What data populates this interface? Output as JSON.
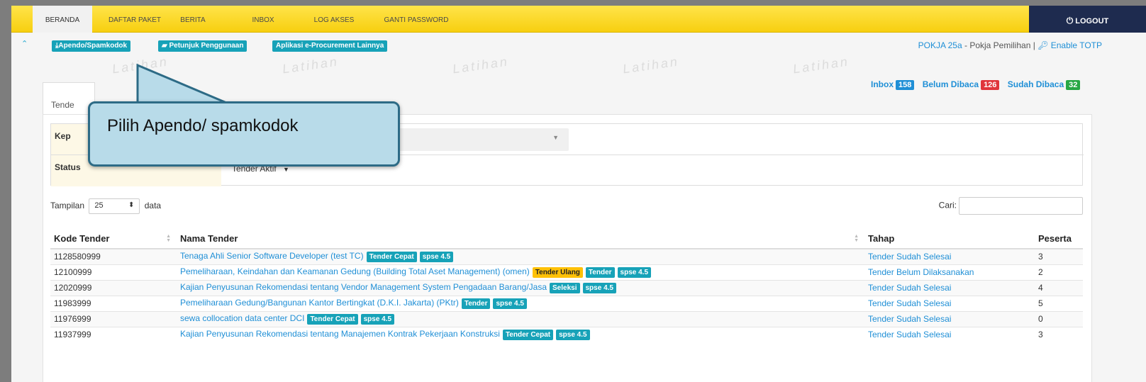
{
  "nav": {
    "items": [
      "BERANDA",
      "DAFTAR PAKET",
      "BERITA",
      "INBOX",
      "LOG AKSES",
      "GANTI PASSWORD"
    ],
    "logout_label": "LOGOUT"
  },
  "subbar": {
    "apendo_label": "Apendo/Spamkodok",
    "petunjuk_label": "Petunjuk Penggunaan",
    "aplikasi_label": "Aplikasi e-Procurement Lainnya",
    "user_name": "POKJA 25a",
    "user_role": " - Pokja Pemilihan | ",
    "enable_totp": "Enable TOTP"
  },
  "watermark": "Latihan",
  "counters": {
    "inbox_label": "Inbox",
    "inbox_count": "158",
    "belum_label": "Belum Dibaca",
    "belum_count": "126",
    "sudah_label": "Sudah Dibaca",
    "sudah_count": "32",
    "colors": {
      "inbox": "#1f8fd6",
      "belum": "#e0353b",
      "sudah": "#28a745"
    }
  },
  "panel": {
    "tab_label": "Tende",
    "filter_kep_label": "Kep",
    "filter_status_label": "Status",
    "status_value": "Tender Aktif",
    "length_prefix": "Tampilan",
    "length_value": "25",
    "length_suffix": "data",
    "search_label": "Cari:"
  },
  "table": {
    "headers": [
      "Kode Tender",
      "Nama Tender",
      "Tahap",
      "Peserta"
    ],
    "rows": [
      {
        "kode": "1128580999",
        "nama": "Tenaga Ahli Senior Software Developer (test TC)",
        "badges": [
          "Tender Cepat",
          "spse 4.5"
        ],
        "tahap": "Tender Sudah Selesai",
        "peserta": "3"
      },
      {
        "kode": "12100999",
        "nama": "Pemeliharaan, Keindahan dan Keamanan Gedung (Building Total Aset Management) (omen)",
        "badges": [
          "Tender Ulang",
          "Tender",
          "spse 4.5"
        ],
        "tahap": "Tender Belum Dilaksanakan",
        "peserta": "2"
      },
      {
        "kode": "12020999",
        "nama": "Kajian Penyusunan Rekomendasi tentang Vendor Management System Pengadaan Barang/Jasa",
        "badges": [
          "Seleksi",
          "spse 4.5"
        ],
        "tahap": "Tender Sudah Selesai",
        "peserta": "4"
      },
      {
        "kode": "11983999",
        "nama": "Pemeliharaan Gedung/Bangunan Kantor Bertingkat (D.K.I. Jakarta) (PKtr)",
        "badges": [
          "Tender",
          "spse 4.5"
        ],
        "tahap": "Tender Sudah Selesai",
        "peserta": "5"
      },
      {
        "kode": "11976999",
        "nama": "sewa collocation data center DCI",
        "badges": [
          "Tender Cepat",
          "spse 4.5"
        ],
        "tahap": "Tender Sudah Selesai",
        "peserta": "0"
      },
      {
        "kode": "11937999",
        "nama": "Kajian Penyusunan Rekomendasi tentang Manajemen Kontrak Pekerjaan Konstruksi",
        "badges": [
          "Tender Cepat",
          "spse 4.5"
        ],
        "tahap": "Tender Sudah Selesai",
        "peserta": "3"
      }
    ]
  },
  "callout": {
    "text": "Pilih Apendo/ spamkodok"
  }
}
